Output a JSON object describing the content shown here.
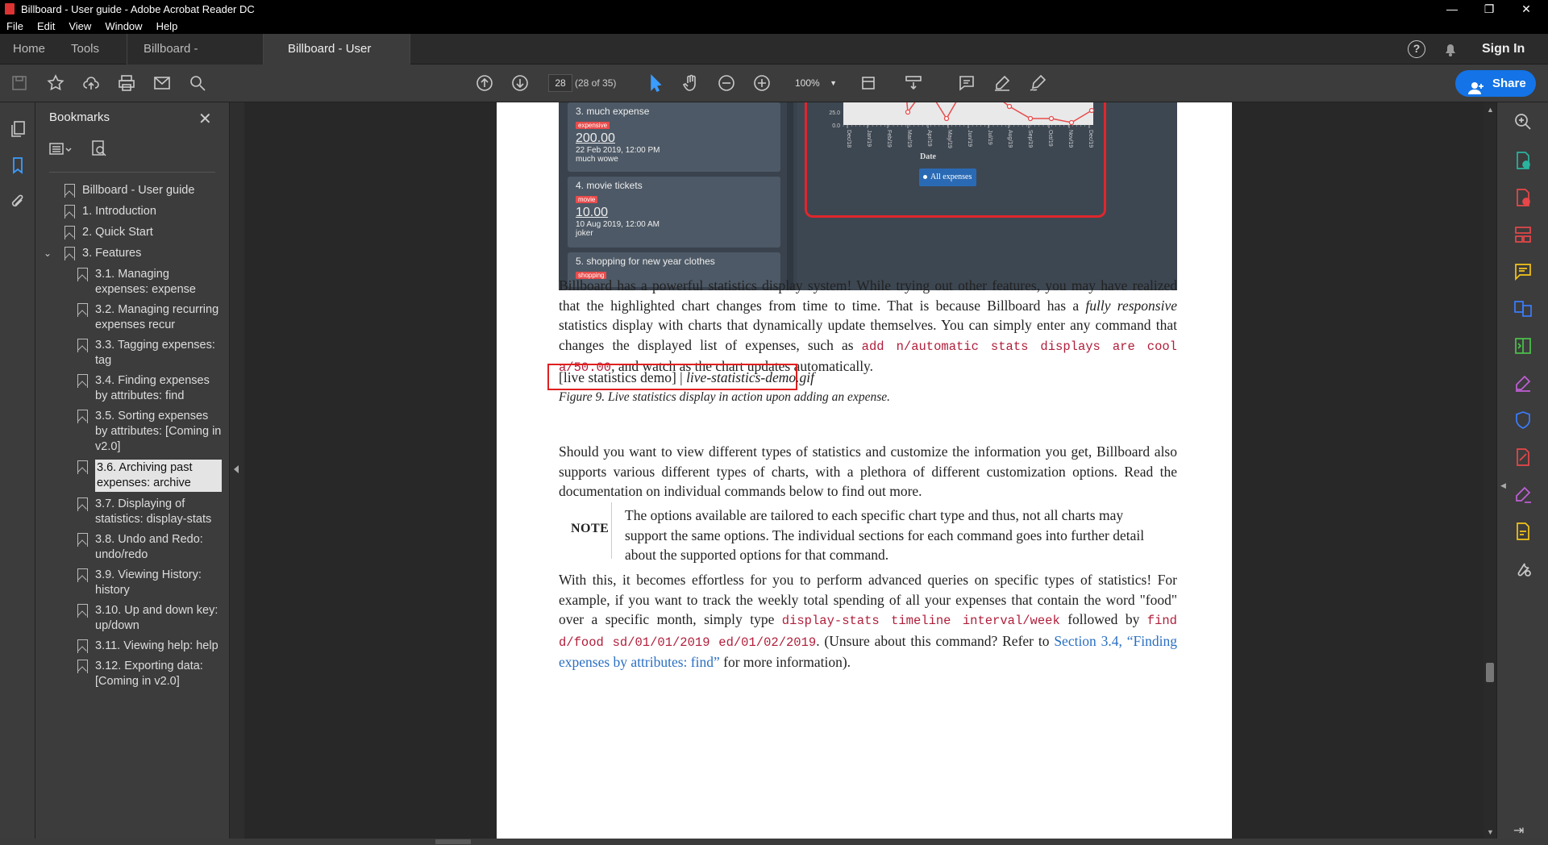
{
  "window": {
    "title": "Billboard - User guide - Adobe Acrobat Reader DC",
    "controls": {
      "min": "—",
      "max": "❐",
      "close": "✕"
    }
  },
  "menu": [
    "File",
    "Edit",
    "View",
    "Window",
    "Help"
  ],
  "tabs": {
    "home": "Home",
    "tools": "Tools",
    "doc1": "Billboard - Develop...",
    "doc2": "Billboard - User gui...",
    "close": "×",
    "sign_in": "Sign In"
  },
  "toolbar": {
    "page_current": "28",
    "page_count": "(28 of 35)",
    "zoom": "100%",
    "share": "Share"
  },
  "bookmarks": {
    "title": "Bookmarks",
    "items": [
      {
        "label": "Billboard - User guide",
        "level": 0
      },
      {
        "label": "1. Introduction",
        "level": 0
      },
      {
        "label": "2. Quick Start",
        "level": 0
      },
      {
        "label": "3. Features",
        "level": 0,
        "expanded": true
      },
      {
        "label": "3.1. Managing expenses: expense",
        "level": 1
      },
      {
        "label": "3.2. Managing recurring expenses recur",
        "level": 1
      },
      {
        "label": "3.3. Tagging expenses: tag",
        "level": 1
      },
      {
        "label": "3.4. Finding expenses by attributes: find",
        "level": 1
      },
      {
        "label": "3.5. Sorting expenses by attributes: [Coming in v2.0]",
        "level": 1
      },
      {
        "label": "3.6. Archiving past expenses: archive",
        "level": 1,
        "selected": true
      },
      {
        "label": "3.7. Displaying of statistics: display-stats",
        "level": 1
      },
      {
        "label": "3.8. Undo and Redo: undo/redo",
        "level": 1
      },
      {
        "label": "3.9. Viewing History: history",
        "level": 1
      },
      {
        "label": "3.10. Up and down key: up/down",
        "level": 1
      },
      {
        "label": "3.11. Viewing help: help",
        "level": 1
      },
      {
        "label": "3.12. Exporting data: [Coming in v2.0]",
        "level": 1
      }
    ]
  },
  "screenshot": {
    "cards": [
      {
        "title": "3.  much expense",
        "tag": "expensive",
        "amount": "200.00",
        "date": "22 Feb 2019, 12:00 PM",
        "desc": "much wowe"
      },
      {
        "title": "4.  movie tickets",
        "tag": "movie",
        "amount": "10.00",
        "date": "10 Aug 2019, 12:00 AM",
        "desc": "joker"
      },
      {
        "title": "5.  shopping for new year clothes",
        "tag": "shopping",
        "amount": "",
        "date": "",
        "desc": ""
      }
    ],
    "chart_data": {
      "type": "line",
      "categories": [
        "Dec/18",
        "Jan/19",
        "Feb/19",
        "Mar/19",
        "Apr/19",
        "May/19",
        "Jun/19",
        "Jul/19",
        "Aug/19",
        "Sep/19",
        "Oct/19",
        "Nov/19",
        "Dec/19"
      ],
      "xlabel": "Date",
      "y_ticks": [
        "25.0",
        "0.0"
      ],
      "legend": "All expenses",
      "series_color": "#e84c4c"
    }
  },
  "page": {
    "p1_a": "Billboard has a powerful statistics display system! While trying out other features, you may have realized that the highlighted chart changes from time to time. That is because Billboard has a ",
    "p1_em": "fully responsive",
    "p1_b": " statistics display with charts that dynamically update themselves. You can simply enter any command that changes the displayed list of expenses, such as ",
    "p1_code": "add n/automatic stats displays are cool a/50.00",
    "p1_c": ", and watch as the chart updates automatically.",
    "fig_alt": "[live statistics demo] | ",
    "fig_file": "live-statistics-demo.gif",
    "fig_caption": "Figure 9. Live statistics display in action upon adding an expense.",
    "p2": "Should you want to view different types of statistics and customize the information you get, Billboard also supports various different types of charts, with a plethora of different customization options. Read the documentation on individual commands below to find out more.",
    "note_label": "NOTE",
    "note_text": "The options available are tailored to each specific chart type and thus, not all charts may support the same options. The individual sections for each command goes into further detail about the supported options for that command.",
    "p3_a": "With this, it becomes effortless for you to perform advanced queries on specific types of statistics! For example, if you want to track the weekly total spending of all your expenses that contain the word \"food\" over a specific month, simply type ",
    "p3_code1": "display-stats timeline interval/week",
    "p3_b": " followed by ",
    "p3_code2": "find d/food sd/01/01/2019 ed/01/02/2019",
    "p3_c": ". (Unsure about this command? Refer to ",
    "p3_link": "Section 3.4, “Finding expenses by attributes: find”",
    "p3_d": " for more information)."
  },
  "colors": {
    "accent": "#1473e6",
    "highlight_box": "#e02020",
    "code": "#b01e3a",
    "link": "#2a6fc2"
  }
}
